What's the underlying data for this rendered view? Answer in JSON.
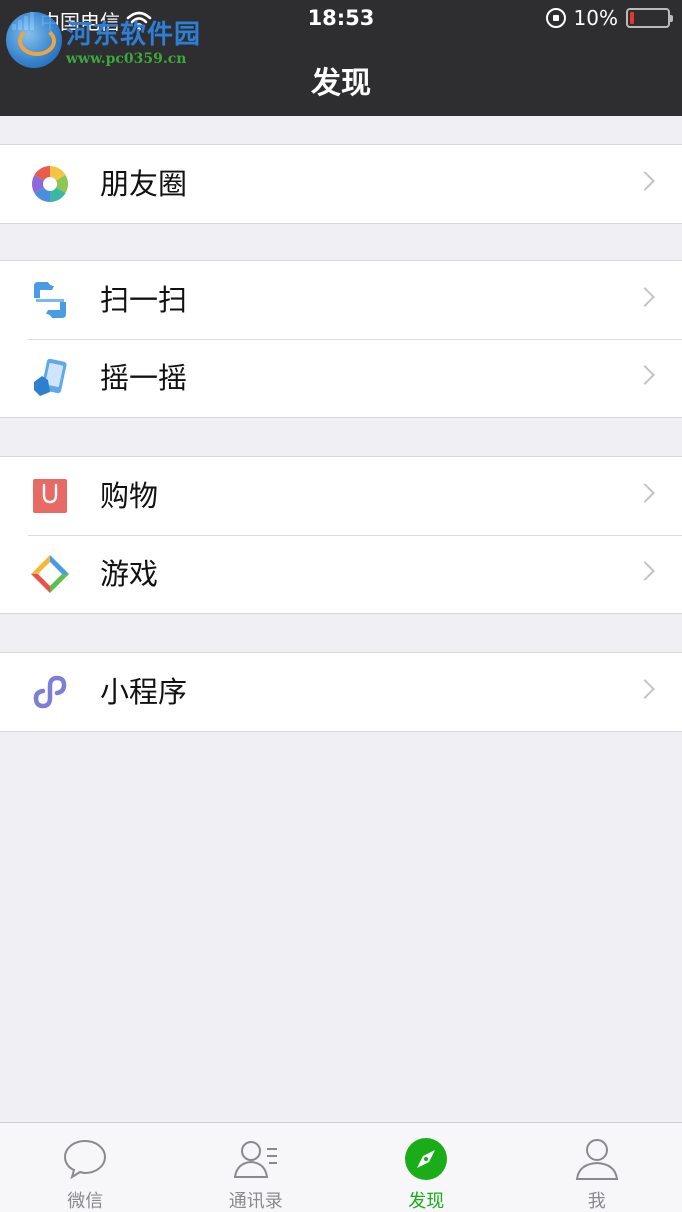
{
  "status_bar": {
    "carrier": "中国电信",
    "time": "18:53",
    "battery_percent": "10%",
    "battery_level": 0.1
  },
  "watermark": {
    "title": "河东软件园",
    "url": "www.pc0359.cn"
  },
  "header": {
    "title": "发现"
  },
  "groups": [
    {
      "items": [
        {
          "label": "朋友圈",
          "icon": "moments-icon"
        }
      ]
    },
    {
      "items": [
        {
          "label": "扫一扫",
          "icon": "scan-icon"
        },
        {
          "label": "摇一摇",
          "icon": "shake-icon"
        }
      ]
    },
    {
      "items": [
        {
          "label": "购物",
          "icon": "shopping-icon"
        },
        {
          "label": "游戏",
          "icon": "games-icon"
        }
      ]
    },
    {
      "items": [
        {
          "label": "小程序",
          "icon": "mini-program-icon"
        }
      ]
    }
  ],
  "tab_bar": {
    "tabs": [
      {
        "label": "微信",
        "icon": "chat-bubble-icon",
        "active": false
      },
      {
        "label": "通讯录",
        "icon": "contacts-icon",
        "active": false
      },
      {
        "label": "发现",
        "icon": "compass-icon",
        "active": true
      },
      {
        "label": "我",
        "icon": "person-icon",
        "active": false
      }
    ]
  },
  "colors": {
    "header_bg": "#2e2e30",
    "page_bg": "#efeff4",
    "active_tab": "#1aad19",
    "inactive_tab": "#8a8a8e",
    "battery_low": "#e8352f"
  }
}
